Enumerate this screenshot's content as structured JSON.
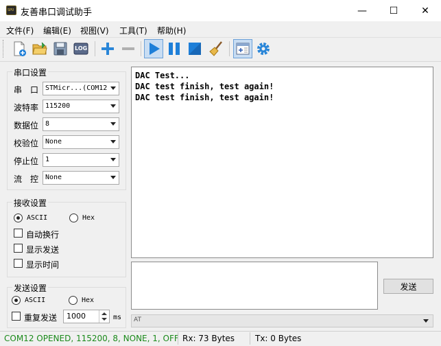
{
  "window": {
    "title": "友善串口调试助手",
    "icon_text": "SPU",
    "minimize_glyph": "—",
    "maximize_glyph": "☐",
    "close_glyph": "✕"
  },
  "menu": [
    "文件(F)",
    "编辑(E)",
    "视图(V)",
    "工具(T)",
    "帮助(H)"
  ],
  "toolbar": {
    "log_label": "LOG",
    "icons": [
      "new-file-icon",
      "open-folder-icon",
      "save-icon",
      "log-icon",
      "add-icon",
      "remove-icon",
      "play-icon",
      "pause-icon",
      "stop-icon",
      "clear-broom-icon",
      "window-layout-icon",
      "settings-gear-icon"
    ],
    "accent": "#1e7fd8"
  },
  "serial": {
    "title": "串口设置",
    "port_label": "串　口",
    "port_value": "STMicr...(COM12",
    "baud_label": "波特率",
    "baud_value": "115200",
    "data_bits_label": "数据位",
    "data_bits_value": "8",
    "parity_label": "校验位",
    "parity_value": "None",
    "stop_bits_label": "停止位",
    "stop_bits_value": "1",
    "flow_label": "流　控",
    "flow_value": "None"
  },
  "receive": {
    "title": "接收设置",
    "ascii_label": "ASCII",
    "hex_label": "Hex",
    "mode": "ascii",
    "auto_wrap_label": "自动换行",
    "show_send_label": "显示发送",
    "show_time_label": "显示时间",
    "text": "DAC Test...\nDAC test finish, test again!\nDAC test finish, test again!"
  },
  "send": {
    "title": "发送设置",
    "ascii_label": "ASCII",
    "hex_label": "Hex",
    "mode": "ascii",
    "repeat_label": "重复发送",
    "interval_value": "1000",
    "interval_unit": "ms",
    "send_button": "发送",
    "history_value": "AT"
  },
  "status": {
    "connection": "COM12 OPENED, 115200, 8, NONE, 1, OFF",
    "rx": "Rx: 73 Bytes",
    "tx": "Tx: 0 Bytes",
    "connection_color": "#1a8a1a"
  }
}
